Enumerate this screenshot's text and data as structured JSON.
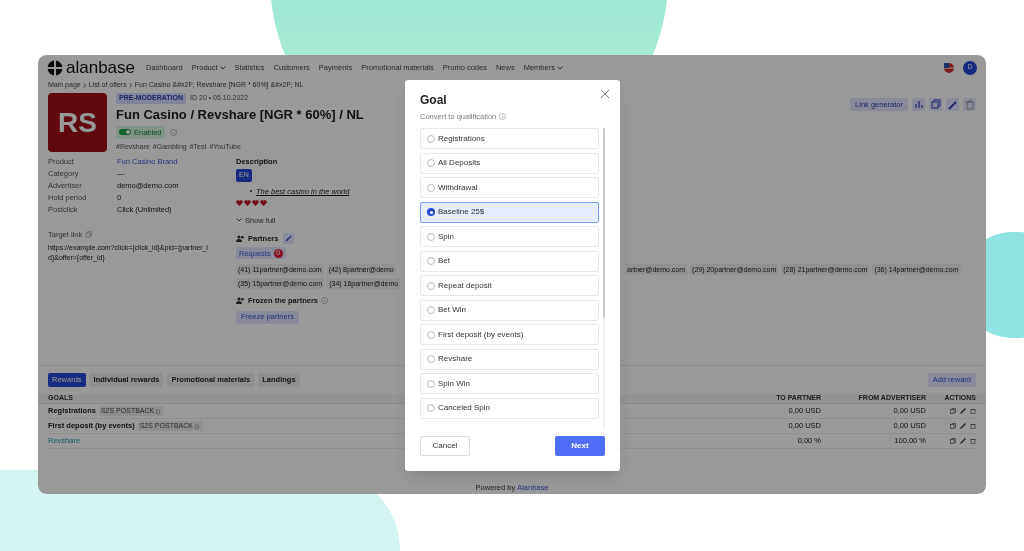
{
  "nav": {
    "logo": "alanbase",
    "items": [
      {
        "label": "Dashboard",
        "dropdown": false
      },
      {
        "label": "Product",
        "dropdown": true
      },
      {
        "label": "Statistics",
        "dropdown": false
      },
      {
        "label": "Customers",
        "dropdown": false
      },
      {
        "label": "Payments",
        "dropdown": false
      },
      {
        "label": "Promotional materials",
        "dropdown": false
      },
      {
        "label": "Promo codes",
        "dropdown": false
      },
      {
        "label": "News",
        "dropdown": false
      },
      {
        "label": "Members",
        "dropdown": true
      }
    ],
    "avatar": "D"
  },
  "breadcrumbs": [
    "Main page",
    "List of offers",
    "Fun Casino &#x2F; Revshare [NGR * 60%] &#x2F; NL"
  ],
  "offer": {
    "logo_text": "RS",
    "status": "PRE-MODERATION",
    "meta": "ID 20 • 05.10.2022",
    "title": "Fun Casino / Revshare [NGR * 60%] / NL",
    "enabled": {
      "label": "Enabled",
      "on": true
    },
    "tags": [
      "#Revshare",
      "#Gambling",
      "#Test",
      "#YouTube"
    ]
  },
  "toolbar": {
    "link_generator": "Link generator"
  },
  "details": [
    {
      "label": "Product",
      "value": "Fun Casino Brand",
      "kind": "link"
    },
    {
      "label": "Category",
      "value": "—",
      "kind": "text"
    },
    {
      "label": "Advertiser",
      "value": "demo@demo.com",
      "kind": "text"
    },
    {
      "label": "Hold period",
      "value": "0",
      "kind": "text"
    },
    {
      "label": "Postclick",
      "value": "Click (Unlimited)",
      "kind": "text"
    }
  ],
  "target_link": {
    "label": "Target link",
    "url": "https://example.com?click={click_id}&pid={partner_id}&offer={offer_id}"
  },
  "description": {
    "title": "Description",
    "lang": "EN",
    "bullet": "The best casino in the world",
    "show_full": "Show full"
  },
  "partners": {
    "title": "Partners",
    "requests": "Requests",
    "requests_count": "0",
    "row_1_left": [
      "(41) 11partner@demo.com",
      "(42) 8partner@demo"
    ],
    "row_1_right": [
      "artner@demo.com",
      "(29) 20partner@demo.com",
      "(28) 21partner@demo.com",
      "(36) 14partner@demo.com"
    ],
    "row_2_left": [
      "(35) 15partner@demo.com",
      "(34) 16partner@demo"
    ]
  },
  "frozen": {
    "title": "Frozen the partners",
    "button": "Freeze partners"
  },
  "tabs": [
    {
      "label": "Rewards",
      "selected": true
    },
    {
      "label": "Individual rewards",
      "selected": false
    },
    {
      "label": "Promotional materials",
      "selected": false
    },
    {
      "label": "Landings",
      "selected": false
    }
  ],
  "add_reward": "Add reward",
  "table": {
    "columns": [
      "GOALS",
      "TO PARTNER",
      "FROM ADVERTISER",
      "ACTIONS"
    ],
    "rows": [
      {
        "goal": "Registrations",
        "kind": "text",
        "tag": "S2S POSTBACK",
        "to_partner": "0,00 USD",
        "from_advertiser": "0,00 USD"
      },
      {
        "goal": "First deposit (by events)",
        "kind": "text",
        "tag": "S2S POSTBACK",
        "to_partner": "0,00 USD",
        "from_advertiser": "0,00 USD"
      },
      {
        "goal": "Revshare",
        "kind": "link",
        "to_partner": "0,00 %",
        "from_advertiser": "100,00 %"
      }
    ]
  },
  "footer": {
    "text": "Powered by",
    "link": "Alanbase"
  },
  "goal_modal": {
    "title": "Goal",
    "subtitle": "Convert to qualification",
    "options": [
      {
        "label": "Registrations",
        "selected": false
      },
      {
        "label": "All Deposits",
        "selected": false
      },
      {
        "label": "Withdrawal",
        "selected": false
      },
      {
        "label": "Baseline 25$",
        "selected": true
      },
      {
        "label": "Spin",
        "selected": false
      },
      {
        "label": "Bet",
        "selected": false
      },
      {
        "label": "Repeat deposit",
        "selected": false
      },
      {
        "label": "Bet Win",
        "selected": false
      },
      {
        "label": "First deposit (by events)",
        "selected": false
      },
      {
        "label": "Revshare",
        "selected": false
      },
      {
        "label": "Spin Win",
        "selected": false
      },
      {
        "label": "Canceled Spin",
        "selected": false
      }
    ],
    "cancel": "Cancel",
    "next": "Next"
  }
}
